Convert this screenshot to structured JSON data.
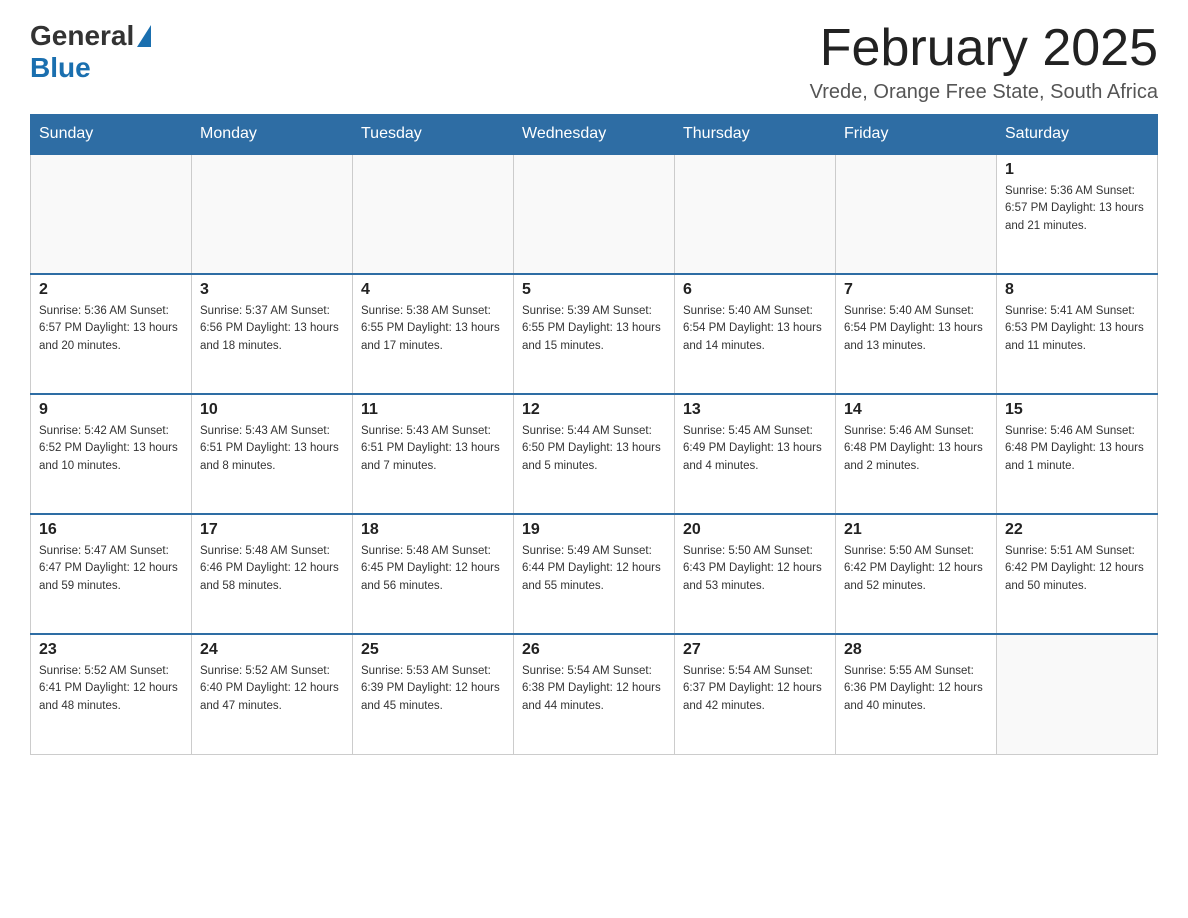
{
  "header": {
    "logo": {
      "general": "General",
      "blue": "Blue"
    },
    "title": "February 2025",
    "location": "Vrede, Orange Free State, South Africa"
  },
  "days_of_week": [
    "Sunday",
    "Monday",
    "Tuesday",
    "Wednesday",
    "Thursday",
    "Friday",
    "Saturday"
  ],
  "weeks": [
    [
      {
        "day": "",
        "info": ""
      },
      {
        "day": "",
        "info": ""
      },
      {
        "day": "",
        "info": ""
      },
      {
        "day": "",
        "info": ""
      },
      {
        "day": "",
        "info": ""
      },
      {
        "day": "",
        "info": ""
      },
      {
        "day": "1",
        "info": "Sunrise: 5:36 AM\nSunset: 6:57 PM\nDaylight: 13 hours and 21 minutes."
      }
    ],
    [
      {
        "day": "2",
        "info": "Sunrise: 5:36 AM\nSunset: 6:57 PM\nDaylight: 13 hours and 20 minutes."
      },
      {
        "day": "3",
        "info": "Sunrise: 5:37 AM\nSunset: 6:56 PM\nDaylight: 13 hours and 18 minutes."
      },
      {
        "day": "4",
        "info": "Sunrise: 5:38 AM\nSunset: 6:55 PM\nDaylight: 13 hours and 17 minutes."
      },
      {
        "day": "5",
        "info": "Sunrise: 5:39 AM\nSunset: 6:55 PM\nDaylight: 13 hours and 15 minutes."
      },
      {
        "day": "6",
        "info": "Sunrise: 5:40 AM\nSunset: 6:54 PM\nDaylight: 13 hours and 14 minutes."
      },
      {
        "day": "7",
        "info": "Sunrise: 5:40 AM\nSunset: 6:54 PM\nDaylight: 13 hours and 13 minutes."
      },
      {
        "day": "8",
        "info": "Sunrise: 5:41 AM\nSunset: 6:53 PM\nDaylight: 13 hours and 11 minutes."
      }
    ],
    [
      {
        "day": "9",
        "info": "Sunrise: 5:42 AM\nSunset: 6:52 PM\nDaylight: 13 hours and 10 minutes."
      },
      {
        "day": "10",
        "info": "Sunrise: 5:43 AM\nSunset: 6:51 PM\nDaylight: 13 hours and 8 minutes."
      },
      {
        "day": "11",
        "info": "Sunrise: 5:43 AM\nSunset: 6:51 PM\nDaylight: 13 hours and 7 minutes."
      },
      {
        "day": "12",
        "info": "Sunrise: 5:44 AM\nSunset: 6:50 PM\nDaylight: 13 hours and 5 minutes."
      },
      {
        "day": "13",
        "info": "Sunrise: 5:45 AM\nSunset: 6:49 PM\nDaylight: 13 hours and 4 minutes."
      },
      {
        "day": "14",
        "info": "Sunrise: 5:46 AM\nSunset: 6:48 PM\nDaylight: 13 hours and 2 minutes."
      },
      {
        "day": "15",
        "info": "Sunrise: 5:46 AM\nSunset: 6:48 PM\nDaylight: 13 hours and 1 minute."
      }
    ],
    [
      {
        "day": "16",
        "info": "Sunrise: 5:47 AM\nSunset: 6:47 PM\nDaylight: 12 hours and 59 minutes."
      },
      {
        "day": "17",
        "info": "Sunrise: 5:48 AM\nSunset: 6:46 PM\nDaylight: 12 hours and 58 minutes."
      },
      {
        "day": "18",
        "info": "Sunrise: 5:48 AM\nSunset: 6:45 PM\nDaylight: 12 hours and 56 minutes."
      },
      {
        "day": "19",
        "info": "Sunrise: 5:49 AM\nSunset: 6:44 PM\nDaylight: 12 hours and 55 minutes."
      },
      {
        "day": "20",
        "info": "Sunrise: 5:50 AM\nSunset: 6:43 PM\nDaylight: 12 hours and 53 minutes."
      },
      {
        "day": "21",
        "info": "Sunrise: 5:50 AM\nSunset: 6:42 PM\nDaylight: 12 hours and 52 minutes."
      },
      {
        "day": "22",
        "info": "Sunrise: 5:51 AM\nSunset: 6:42 PM\nDaylight: 12 hours and 50 minutes."
      }
    ],
    [
      {
        "day": "23",
        "info": "Sunrise: 5:52 AM\nSunset: 6:41 PM\nDaylight: 12 hours and 48 minutes."
      },
      {
        "day": "24",
        "info": "Sunrise: 5:52 AM\nSunset: 6:40 PM\nDaylight: 12 hours and 47 minutes."
      },
      {
        "day": "25",
        "info": "Sunrise: 5:53 AM\nSunset: 6:39 PM\nDaylight: 12 hours and 45 minutes."
      },
      {
        "day": "26",
        "info": "Sunrise: 5:54 AM\nSunset: 6:38 PM\nDaylight: 12 hours and 44 minutes."
      },
      {
        "day": "27",
        "info": "Sunrise: 5:54 AM\nSunset: 6:37 PM\nDaylight: 12 hours and 42 minutes."
      },
      {
        "day": "28",
        "info": "Sunrise: 5:55 AM\nSunset: 6:36 PM\nDaylight: 12 hours and 40 minutes."
      },
      {
        "day": "",
        "info": ""
      }
    ]
  ],
  "colors": {
    "header_bg": "#2e6da4",
    "header_text": "#ffffff",
    "border": "#cccccc",
    "blue_accent": "#1a6faf"
  }
}
